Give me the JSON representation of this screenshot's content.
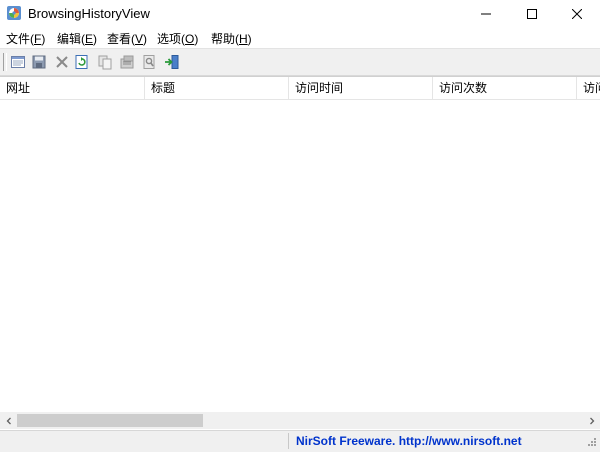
{
  "window": {
    "title": "BrowsingHistoryView"
  },
  "menu": {
    "items": [
      {
        "label": "文件(",
        "key": "F",
        "tail": ")"
      },
      {
        "label": "编辑(",
        "key": "E",
        "tail": ")"
      },
      {
        "label": "查看(",
        "key": "V",
        "tail": ")"
      },
      {
        "label": "选项(",
        "key": "O",
        "tail": ")"
      },
      {
        "label": "帮助(",
        "key": "H",
        "tail": ")"
      }
    ]
  },
  "toolbar": {
    "icons": [
      "html-report-icon",
      "save-icon",
      "delete-icon",
      "refresh-icon",
      "copy-icon",
      "properties-icon",
      "find-icon",
      "exit-icon"
    ]
  },
  "list": {
    "columns": [
      "网址",
      "标题",
      "访问时间",
      "访问次数",
      "访问"
    ]
  },
  "status": {
    "link_text": "NirSoft Freeware.  http://www.nirsoft.net"
  },
  "colors": {
    "link": "#0033cc",
    "toolbar_bg": "#f0f0f0",
    "scroll_thumb": "#cdcdcd"
  }
}
